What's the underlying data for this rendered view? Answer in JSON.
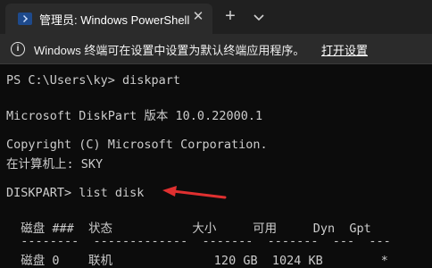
{
  "tab": {
    "title": "管理员: Windows PowerShell",
    "close_glyph": "✕",
    "new_tab_glyph": "+",
    "icon": "powershell-icon"
  },
  "infobar": {
    "icon": "info-icon",
    "message": "Windows 终端可在设置中设置为默认终端应用程序。",
    "link": "打开设置"
  },
  "terminal": {
    "lines": [
      "PS C:\\Users\\ky> diskpart",
      "",
      "Microsoft DiskPart 版本 10.0.22000.1",
      "",
      "Copyright (C) Microsoft Corporation.",
      "在计算机上: SKY",
      "",
      "DISKPART> list disk",
      "",
      "  磁盘 ###  状态           大小     可用     Dyn  Gpt",
      "  --------  -------------  -------  -------  ---  ---",
      "  磁盘 0    联机              120 GB  1024 KB        *"
    ]
  },
  "annotation": {
    "arrow_color": "#e03030"
  },
  "colors": {
    "terminal_bg": "#0c0c0c",
    "terminal_text": "#cccccc",
    "tabbar_bg": "#202020",
    "infobar_bg": "#2b2b2b"
  }
}
